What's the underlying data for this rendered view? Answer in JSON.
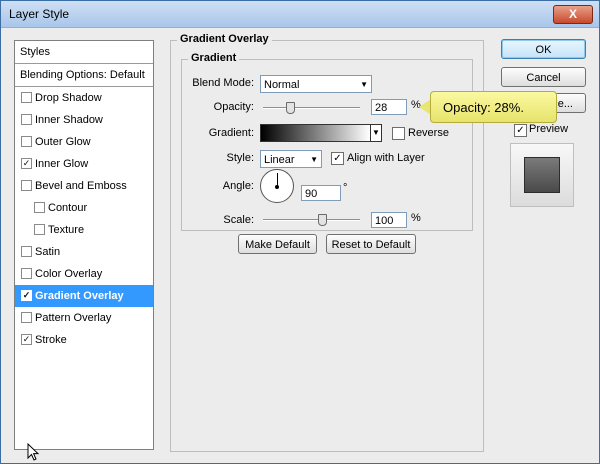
{
  "window": {
    "title": "Layer Style",
    "close_label": "X"
  },
  "styles_panel": {
    "header": "Styles",
    "blending": "Blending Options: Default",
    "items": [
      {
        "label": "Drop Shadow",
        "checked": false,
        "indent": false,
        "selected": false
      },
      {
        "label": "Inner Shadow",
        "checked": false,
        "indent": false,
        "selected": false
      },
      {
        "label": "Outer Glow",
        "checked": false,
        "indent": false,
        "selected": false
      },
      {
        "label": "Inner Glow",
        "checked": true,
        "indent": false,
        "selected": false
      },
      {
        "label": "Bevel and Emboss",
        "checked": false,
        "indent": false,
        "selected": false
      },
      {
        "label": "Contour",
        "checked": false,
        "indent": true,
        "selected": false
      },
      {
        "label": "Texture",
        "checked": false,
        "indent": true,
        "selected": false
      },
      {
        "label": "Satin",
        "checked": false,
        "indent": false,
        "selected": false
      },
      {
        "label": "Color Overlay",
        "checked": false,
        "indent": false,
        "selected": false
      },
      {
        "label": "Gradient Overlay",
        "checked": true,
        "indent": false,
        "selected": true
      },
      {
        "label": "Pattern Overlay",
        "checked": false,
        "indent": false,
        "selected": false
      },
      {
        "label": "Stroke",
        "checked": true,
        "indent": false,
        "selected": false
      }
    ]
  },
  "gradient_overlay": {
    "section_title": "Gradient Overlay",
    "group_title": "Gradient",
    "blend_mode": {
      "label": "Blend Mode:",
      "value": "Normal"
    },
    "opacity": {
      "label": "Opacity:",
      "value": "28",
      "unit": "%",
      "level": 0.28
    },
    "gradient": {
      "label": "Gradient:",
      "reverse_label": "Reverse",
      "reverse_checked": false
    },
    "style": {
      "label": "Style:",
      "value": "Linear",
      "align_label": "Align with Layer",
      "align_checked": true
    },
    "angle": {
      "label": "Angle:",
      "value": "90",
      "unit": "°"
    },
    "scale": {
      "label": "Scale:",
      "value": "100",
      "unit": "%",
      "level": 0.42
    },
    "make_default": "Make Default",
    "reset_default": "Reset to Default"
  },
  "buttons": {
    "ok": "OK",
    "cancel": "Cancel",
    "new_style_partial": "e...",
    "preview_label": "Preview",
    "preview_checked": true
  },
  "tooltip": {
    "text": "Opacity: 28%."
  },
  "colors": {
    "selection": "#3399ff",
    "callout": "#f3f08a"
  }
}
